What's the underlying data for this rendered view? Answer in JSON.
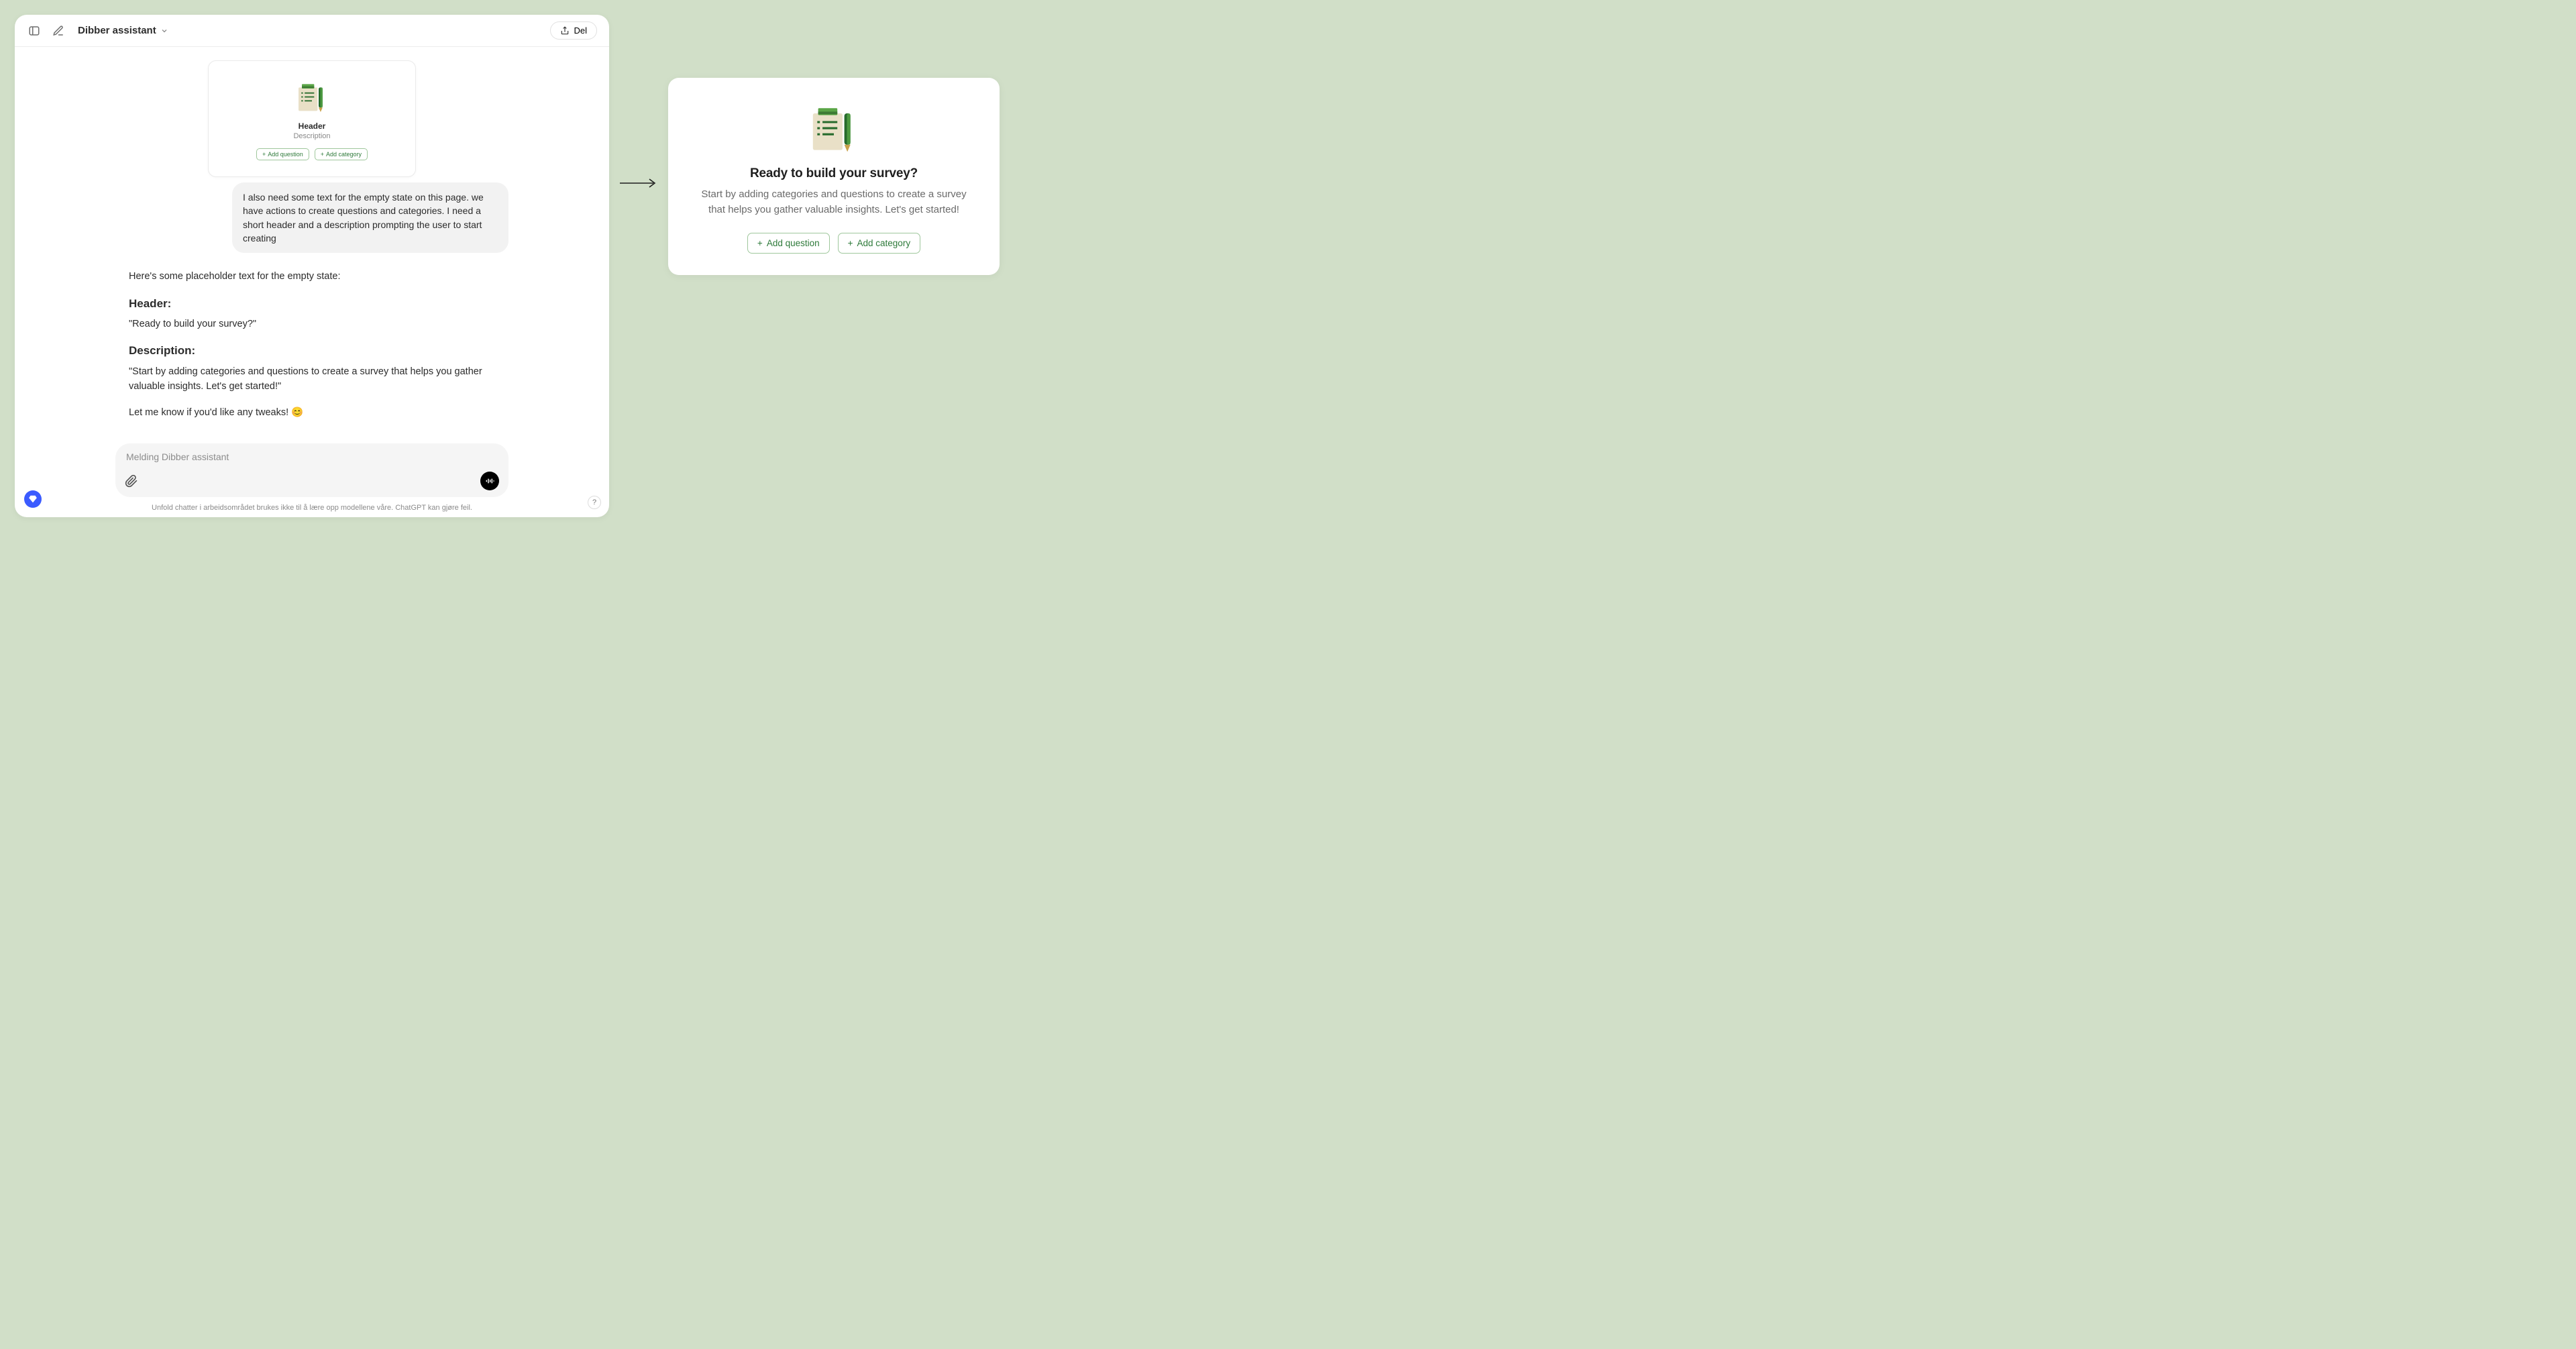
{
  "chat": {
    "title": "Dibber assistant",
    "share_label": "Del",
    "embedded": {
      "header": "Header",
      "description": "Description",
      "add_question": "Add question",
      "add_category": "Add category"
    },
    "user_message": "I also need some text for the empty state on this page. we have actions to create questions and categories. I need a short header and a description prompting the user to start creating",
    "assistant": {
      "intro": "Here's some placeholder text for the empty state:",
      "header_label": "Header:",
      "header_value": "\"Ready to build your survey?\"",
      "description_label": "Description:",
      "description_value": "\"Start by adding categories and questions to create a survey that helps you gather valuable insights. Let's get started!\"",
      "outro": "Let me know if you'd like any tweaks! 😊"
    },
    "input_placeholder": "Melding Dibber assistant",
    "disclaimer": "Unfold chatter i arbeidsområdet brukes ikke til å lære opp modellene våre. ChatGPT kan gjøre feil.",
    "help": "?"
  },
  "result": {
    "header": "Ready to build your survey?",
    "description": "Start by adding categories and questions to create a survey that helps you gather valuable insights. Let's get started!",
    "add_question": "Add question",
    "add_category": "Add category"
  }
}
